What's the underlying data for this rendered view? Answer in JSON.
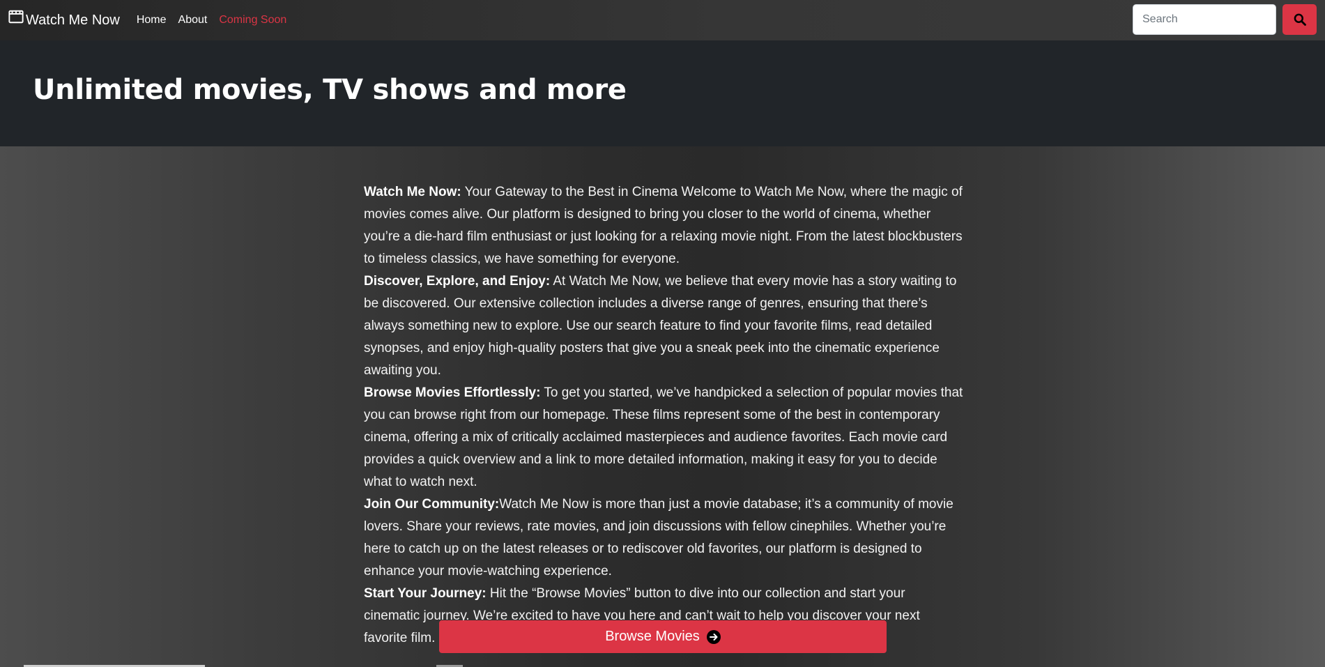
{
  "navbar": {
    "brand": "Watch Me Now",
    "links": [
      {
        "label": "Home"
      },
      {
        "label": "About"
      },
      {
        "label": "Coming Soon"
      }
    ],
    "active_link": "Coming Soon",
    "search": {
      "placeholder": "Search",
      "value": ""
    },
    "icons": {
      "brand": "film-icon",
      "search": "search-icon"
    }
  },
  "hero": {
    "title": "Unlimited movies, TV shows and more"
  },
  "content": {
    "sections": [
      {
        "heading": "Watch Me Now:",
        "text": " Your Gateway to the Best in Cinema Welcome to Watch Me Now, where the magic of movies comes alive. Our platform is designed to bring you closer to the world of cinema, whether you’re a die-hard film enthusiast or just looking for a relaxing movie night. From the latest blockbusters to timeless classics, we have something for everyone."
      },
      {
        "heading": "Discover, Explore, and Enjoy:",
        "text": " At Watch Me Now, we believe that every movie has a story waiting to be discovered. Our extensive collection includes a diverse range of genres, ensuring that there’s always something new to explore. Use our search feature to find your favorite films, read detailed synopses, and enjoy high-quality posters that give you a sneak peek into the cinematic experience awaiting you."
      },
      {
        "heading": "Browse Movies Effortlessly:",
        "text": " To get you started, we’ve handpicked a selection of popular movies that you can browse right from our homepage. These films represent some of the best in contemporary cinema, offering a mix of critically acclaimed masterpieces and audience favorites. Each movie card provides a quick overview and a link to more detailed information, making it easy for you to decide what to watch next."
      },
      {
        "heading": "Join Our Community:",
        "text": "Watch Me Now is more than just a movie database; it’s a community of movie lovers. Share your reviews, rate movies, and join discussions with fellow cinephiles. Whether you’re here to catch up on the latest releases or to rediscover old favorites, our platform is designed to enhance your movie-watching experience."
      },
      {
        "heading": "Start Your Journey:",
        "text": " Hit the “Browse Movies” button to dive into our collection and start your cinematic journey. We’re excited to have you here and can’t wait to help you discover your next favorite film."
      }
    ],
    "browse_button": {
      "label": "Browse Movies",
      "icon": "arrow-right-circle-icon"
    }
  },
  "colors": {
    "accent": "#dc3545",
    "navbar_bg": "#2f2f2f",
    "hero_bg": "#212529",
    "text": "#f2f2f2"
  }
}
